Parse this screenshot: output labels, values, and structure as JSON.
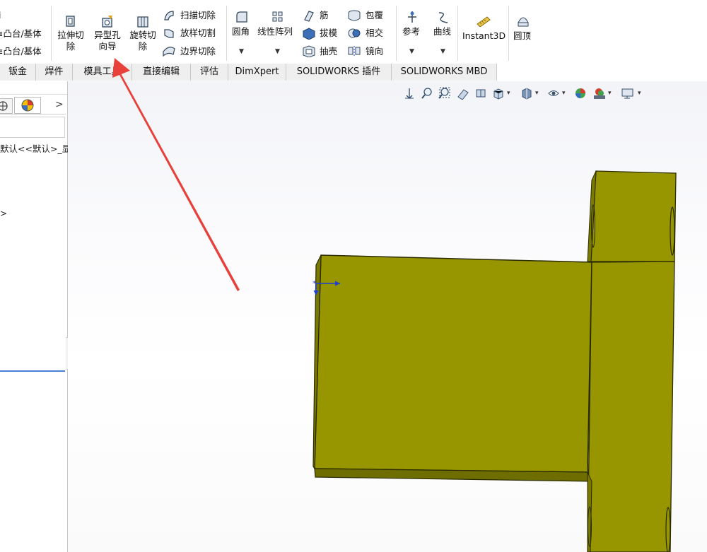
{
  "ribbon": {
    "partial_labels": [
      "i",
      "≡凸台/基体",
      "≡凸台/基体"
    ],
    "extrude_cut": [
      "拉伸切",
      "除"
    ],
    "hole_wizard": [
      "异型孔",
      "向导"
    ],
    "revolve_cut": [
      "旋转切",
      "除"
    ],
    "swept_cut": "扫描切除",
    "lofted_cut": "放样切割",
    "boundary_cut": "边界切除",
    "fillet": "圆角",
    "linear_pattern": "线性阵列",
    "rib": "筋",
    "draft": "拔模",
    "shell": "抽壳",
    "wrap": "包覆",
    "intersect": "相交",
    "mirror": "镜向",
    "reference": "参考",
    "curves": "曲线",
    "instant3d": "Instant3D",
    "dome": "圆顶"
  },
  "tabs": [
    "钣金",
    "焊件",
    "模具工具",
    "直接编辑",
    "评估",
    "DimXpert",
    "SOLIDWORKS 插件",
    "SOLIDWORKS MBD"
  ],
  "left_panel": {
    "tree_line": "默认<<默认>_显",
    "chevron": ">",
    "small_arrow": ">"
  },
  "colors": {
    "part_face": "#979600",
    "part_edge": "#2a2a00",
    "arrow_red": "#e8403a",
    "axis_blue": "#1f3fd6"
  }
}
